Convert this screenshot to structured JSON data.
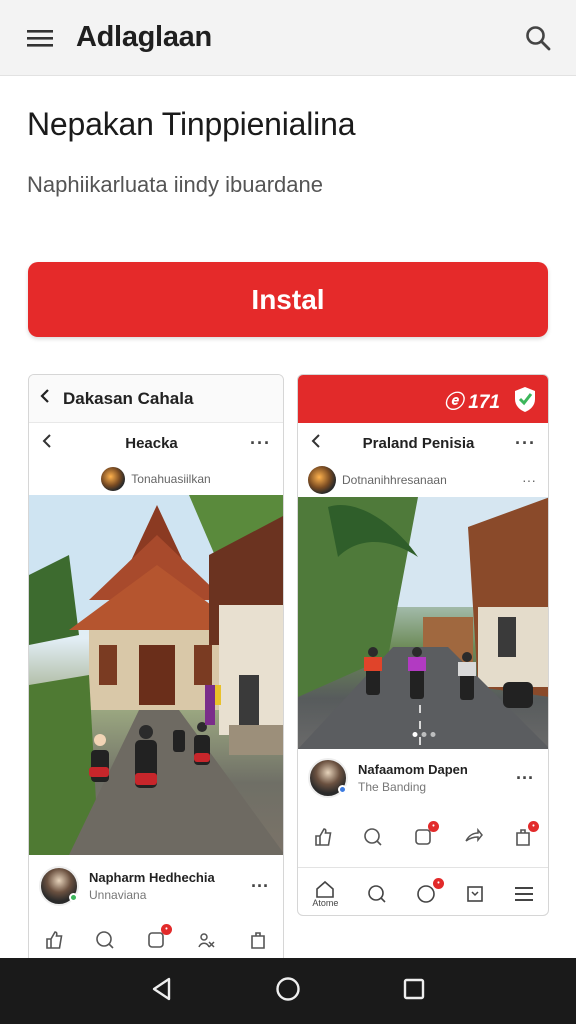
{
  "appbar": {
    "title": "Adlaglaan",
    "menu_icon": "hamburger-menu-icon",
    "search_icon": "search-icon"
  },
  "headline": "Nepakan Tinppienialina",
  "subline": "Naphiikarluata iindy ibuardane",
  "install_label": "Instal",
  "colors": {
    "accent": "#e52a2a",
    "appbar": "#f3f3f3",
    "navbar": "#1a1a1a"
  },
  "screenshot_left": {
    "top_title": "Dakasan Cahala",
    "post_title": "Heacka",
    "author": "Tonahuasiilkan",
    "poster_name": "Napharm Hedhechia",
    "poster_sub": "Unnaviana"
  },
  "screenshot_right": {
    "badge": "ⓔ 171",
    "post_title": "Praland Penisia",
    "author": "Dotnanihhresanaan",
    "poster_name": "Nafaamom Dapen",
    "poster_sub": "The Banding",
    "tab_home_label": "Atome"
  }
}
